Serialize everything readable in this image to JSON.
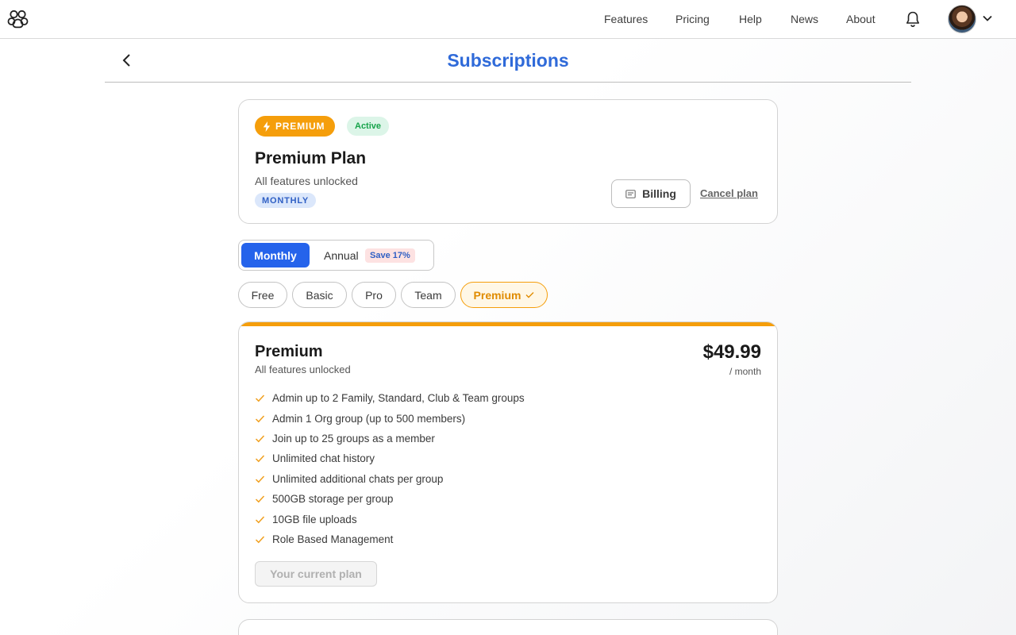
{
  "nav": {
    "links": [
      "Features",
      "Pricing",
      "Help",
      "News",
      "About"
    ]
  },
  "page": {
    "title": "Subscriptions"
  },
  "current_plan": {
    "tier_badge": "PREMIUM",
    "status_badge": "Active",
    "name": "Premium Plan",
    "description": "All features unlocked",
    "cycle_badge": "MONTHLY",
    "billing_label": "Billing",
    "cancel_label": "Cancel plan"
  },
  "billing_toggle": {
    "monthly": "Monthly",
    "annual": "Annual",
    "save_badge": "Save 17%",
    "selected": "Monthly"
  },
  "plan_tabs": [
    {
      "label": "Free",
      "selected": false
    },
    {
      "label": "Basic",
      "selected": false
    },
    {
      "label": "Pro",
      "selected": false
    },
    {
      "label": "Team",
      "selected": false
    },
    {
      "label": "Premium",
      "selected": true
    }
  ],
  "plan_detail": {
    "name": "Premium",
    "description": "All features unlocked",
    "price": "$49.99",
    "period": "/ month",
    "features": [
      "Admin up to 2 Family, Standard, Club & Team groups",
      "Admin 1 Org group (up to 500 members)",
      "Join up to 25 groups as a member",
      "Unlimited chat history",
      "Unlimited additional chats per group",
      "500GB storage per group",
      "10GB file uploads",
      "Role Based Management"
    ],
    "action_label": "Your current plan"
  },
  "colors": {
    "accent_blue": "#2563eb",
    "title_blue": "#2f6ad9",
    "premium_orange": "#f59e0b",
    "active_green": "#16a34a"
  },
  "icons": {
    "logo": "paw-logo-icon",
    "bell": "bell-icon",
    "chevron": "chevron-down-icon",
    "back": "chevron-left-icon",
    "bolt": "lightning-bolt-icon",
    "billing": "receipt-icon",
    "check": "check-icon"
  }
}
